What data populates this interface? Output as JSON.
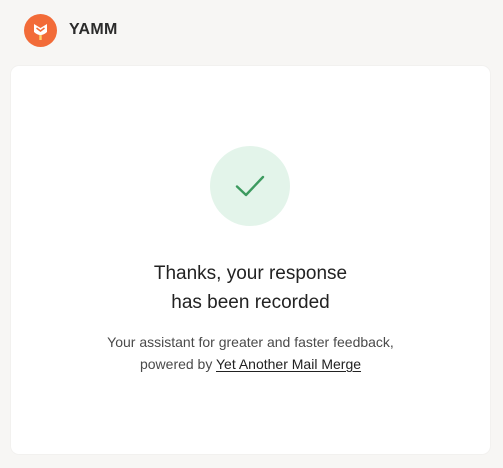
{
  "header": {
    "brand": "YAMM",
    "logo_icon": "yamm-logo-icon",
    "brand_color": "#f26b38"
  },
  "confirmation": {
    "icon": "checkmark-icon",
    "icon_color": "#3c9a5f",
    "icon_bg_color": "#e3f4ea",
    "title_line1": "Thanks, your response",
    "title_line2": "has been recorded",
    "subtitle_line1": "Your assistant for greater and faster feedback,",
    "subtitle_prefix": "powered by",
    "link_text": "Yet Another Mail Merge"
  }
}
